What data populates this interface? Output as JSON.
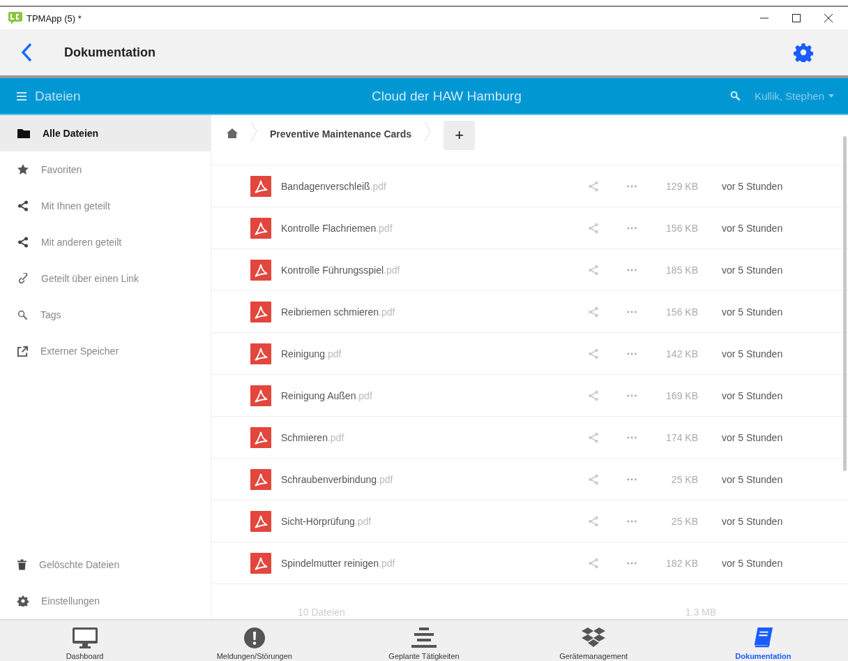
{
  "window": {
    "title": "TPMApp (5) *"
  },
  "header": {
    "title": "Dokumentation"
  },
  "toolbar": {
    "title": "Dateien",
    "center": "Cloud der HAW Hamburg",
    "user": "Kullik, Stephen"
  },
  "sidebar": {
    "items": [
      {
        "label": "Alle Dateien",
        "selected": true
      },
      {
        "label": "Favoriten",
        "selected": false
      },
      {
        "label": "Mit Ihnen geteilt",
        "selected": false
      },
      {
        "label": "Mit anderen geteilt",
        "selected": false
      },
      {
        "label": "Geteilt über einen Link",
        "selected": false
      },
      {
        "label": "Tags",
        "selected": false
      },
      {
        "label": "Externer Speicher",
        "selected": false
      }
    ],
    "bottom_items": [
      {
        "label": "Gelöschte Dateien"
      },
      {
        "label": "Einstellungen"
      }
    ]
  },
  "breadcrumb": {
    "folder": "Preventive Maintenance Cards",
    "add": "+"
  },
  "files": [
    {
      "name": "Bandagenverschleiß",
      "ext": ".pdf",
      "size": "129 KB",
      "modified": "vor 5 Stunden"
    },
    {
      "name": "Kontrolle Flachriemen",
      "ext": ".pdf",
      "size": "156 KB",
      "modified": "vor 5 Stunden"
    },
    {
      "name": "Kontrolle Führungsspiel",
      "ext": ".pdf",
      "size": "185 KB",
      "modified": "vor 5 Stunden"
    },
    {
      "name": "Reibriemen schmieren",
      "ext": ".pdf",
      "size": "156 KB",
      "modified": "vor 5 Stunden"
    },
    {
      "name": "Reinigung",
      "ext": ".pdf",
      "size": "142 KB",
      "modified": "vor 5 Stunden"
    },
    {
      "name": "Reinigung Außen",
      "ext": ".pdf",
      "size": "169 KB",
      "modified": "vor 5 Stunden"
    },
    {
      "name": "Schmieren",
      "ext": ".pdf",
      "size": "174 KB",
      "modified": "vor 5 Stunden"
    },
    {
      "name": "Schraubenverbindung",
      "ext": ".pdf",
      "size": "25 KB",
      "modified": "vor 5 Stunden"
    },
    {
      "name": "Sicht-Hörprüfung",
      "ext": ".pdf",
      "size": "25 KB",
      "modified": "vor 5 Stunden"
    },
    {
      "name": "Spindelmutter reinigen",
      "ext": ".pdf",
      "size": "182 KB",
      "modified": "vor 5 Stunden"
    }
  ],
  "summary": {
    "count": "10 Dateien",
    "size": "1.3 MB"
  },
  "nav": [
    {
      "label": "Dashboard",
      "selected": false
    },
    {
      "label": "Meldungen/Störungen",
      "selected": false
    },
    {
      "label": "Geplante Tätigkeiten",
      "selected": false
    },
    {
      "label": "Gerätemanagement",
      "selected": false
    },
    {
      "label": "Dokumentation",
      "selected": true
    }
  ]
}
